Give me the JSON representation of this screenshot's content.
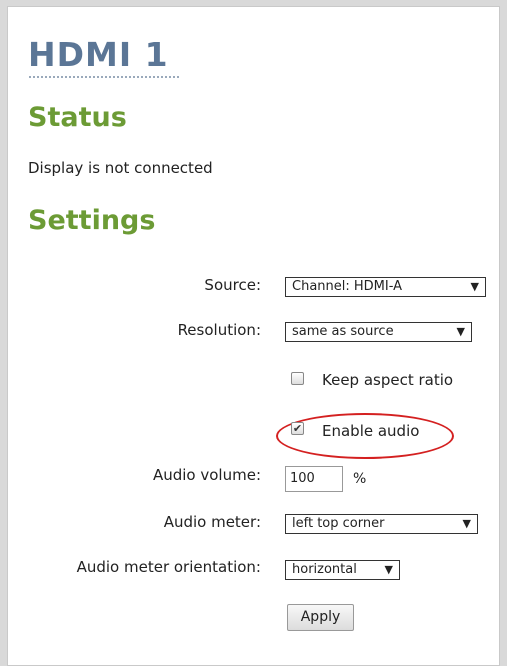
{
  "page_title": "HDMI 1",
  "status": {
    "heading": "Status",
    "text": "Display is not connected"
  },
  "settings": {
    "heading": "Settings",
    "source_label": "Source:",
    "source_value": "Channel: HDMI-A",
    "resolution_label": "Resolution:",
    "resolution_value": "same as source",
    "keep_aspect_label": "Keep aspect ratio",
    "keep_aspect_checked": false,
    "enable_audio_label": "Enable audio",
    "enable_audio_checked": true,
    "audio_volume_label": "Audio volume:",
    "audio_volume_value": "100",
    "audio_volume_unit": "%",
    "audio_meter_label": "Audio meter:",
    "audio_meter_value": "left top corner",
    "orientation_label": "Audio meter orientation:",
    "orientation_value": "horizontal",
    "apply_label": "Apply",
    "dropdown_arrow": "▼",
    "checkmark": "✔"
  },
  "colors": {
    "title": "#5b7696",
    "heading": "#6c9b35",
    "highlight": "#d42020"
  }
}
